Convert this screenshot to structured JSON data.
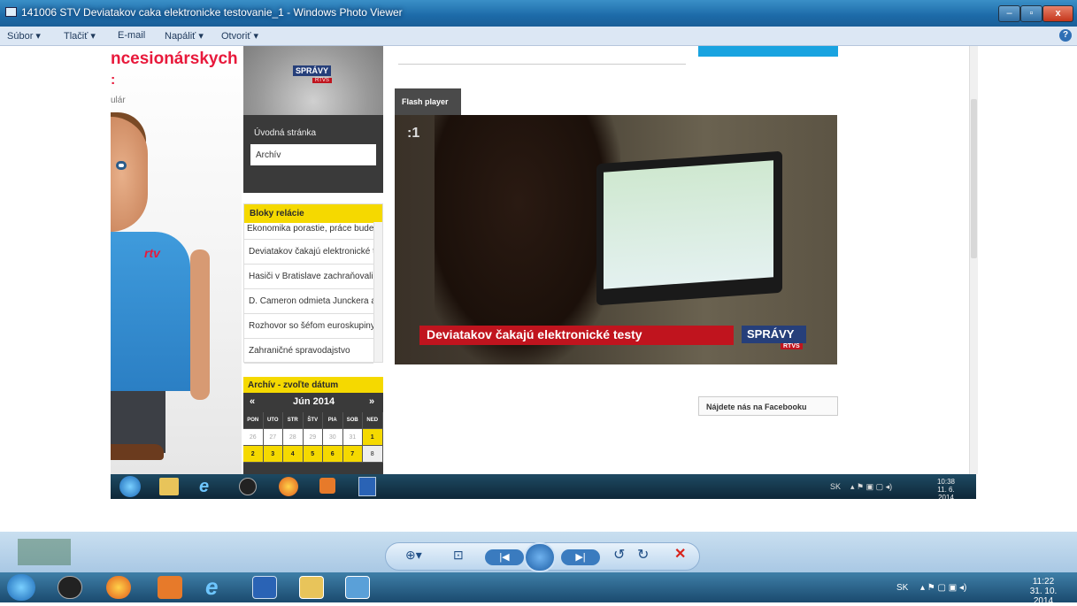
{
  "window": {
    "title": "141006 STV Deviatakov caka elektronicke testovanie_1 - Windows Photo Viewer"
  },
  "menu": {
    "file": "Súbor",
    "print": "Tlačiť",
    "email": "E-mail",
    "burn": "Napáliť",
    "open": "Otvoriť"
  },
  "page": {
    "heading_fragment": "ncesionárskych",
    "subtext_fragment": "ulár",
    "logo_label": "SPRÁVY",
    "logo_sub": "RTVS",
    "nav": {
      "home": "Úvodná stránka",
      "archive": "Archív"
    },
    "blocks": {
      "title": "Bloky relácie",
      "items": [
        "Ekonomika porastie, práce bude vi...",
        "Deviatakov čakajú elektronické testy",
        "Hasiči v Bratislave zachraňovali ha...",
        "D. Cameron odmieta Junckera ako...",
        "Rozhovor so šéfom euroskupiny",
        "Zahraničné spravodajstvo"
      ]
    },
    "archive": {
      "title": "Archív - zvoľte dátum",
      "month": "Jún 2014",
      "prev": "«",
      "next": "»",
      "days": [
        "PON",
        "UTO",
        "STR",
        "ŠTV",
        "PIA",
        "SOB",
        "NED"
      ],
      "row1": [
        "26",
        "27",
        "28",
        "29",
        "30",
        "31",
        "1"
      ],
      "row2": [
        "2",
        "3",
        "4",
        "5",
        "6",
        "7",
        "8"
      ]
    },
    "player": {
      "tab": "Flash player",
      "channel": ":1",
      "caption": "Deviatakov čakajú elektronické testy",
      "brand": "SPRÁVY",
      "brand_sub": "RTVS"
    },
    "facebook": "Nájdete nás na Facebooku"
  },
  "inner_taskbar": {
    "lang": "SK",
    "time": "10:38",
    "date": "11. 6. 2014"
  },
  "taskbar": {
    "lang": "SK",
    "time": "11:22",
    "date": "31. 10. 2014"
  },
  "colors": {
    "accent_yellow": "#f5d900",
    "heading_red": "#e8193b",
    "caption_red": "#c0141e"
  }
}
